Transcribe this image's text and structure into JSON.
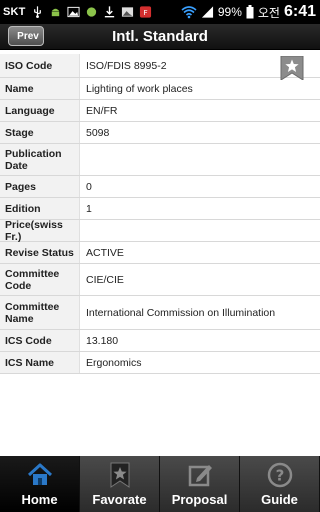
{
  "status_bar": {
    "carrier": "SKT",
    "battery": "99%",
    "ime": "오전",
    "time": "6:41"
  },
  "header": {
    "title": "Intl. Standard",
    "prev_label": "Prev"
  },
  "details": [
    {
      "label": "ISO Code",
      "value": "ISO/FDIS 8995-2"
    },
    {
      "label": "Name",
      "value": "Lighting of work places"
    },
    {
      "label": "Language",
      "value": "EN/FR"
    },
    {
      "label": "Stage",
      "value": "5098"
    },
    {
      "label": "Publication Date",
      "value": ""
    },
    {
      "label": "Pages",
      "value": "0"
    },
    {
      "label": "Edition",
      "value": "1"
    },
    {
      "label": "Price(swiss Fr.)",
      "value": ""
    },
    {
      "label": "Revise Status",
      "value": "ACTIVE"
    },
    {
      "label": "Committee Code",
      "value": "CIE/CIE"
    },
    {
      "label": "Committee Name",
      "value": "International Commission on Illumination"
    },
    {
      "label": "ICS Code",
      "value": "13.180"
    },
    {
      "label": "ICS Name",
      "value": "Ergonomics"
    }
  ],
  "tabs": [
    {
      "label": "Home",
      "icon": "home-icon"
    },
    {
      "label": "Favorate",
      "icon": "star-icon"
    },
    {
      "label": "Proposal",
      "icon": "edit-icon"
    },
    {
      "label": "Guide",
      "icon": "question-icon"
    }
  ],
  "colors": {
    "active_tab_icon": "#2a78c8",
    "accent_blue": "#1f6fc0"
  }
}
